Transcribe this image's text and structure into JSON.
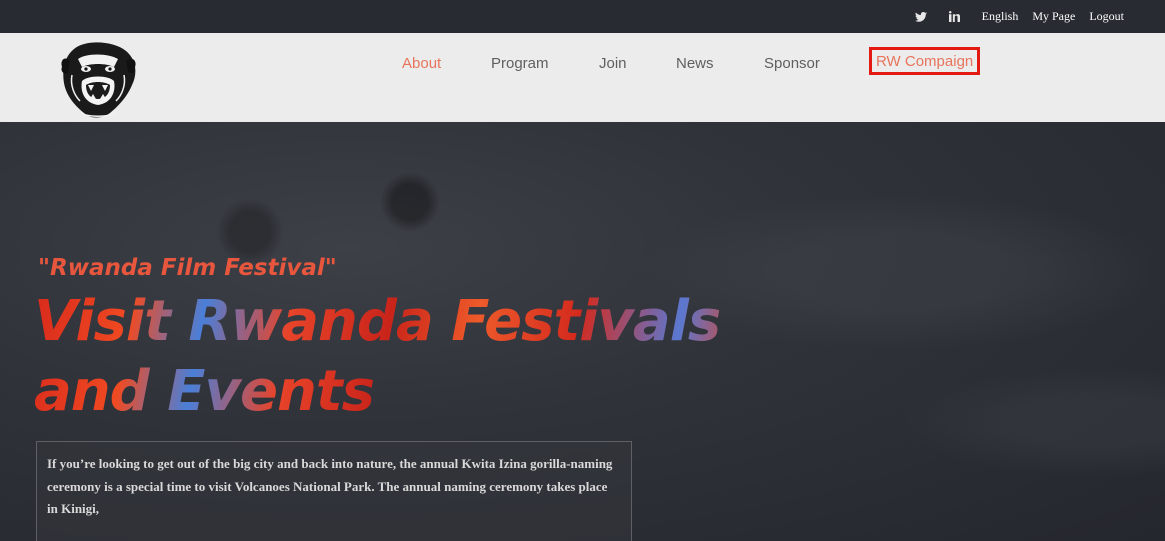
{
  "topbar": {
    "icons": [
      {
        "name": "twitter-icon",
        "glyph": "twitter"
      },
      {
        "name": "linkedin-icon",
        "glyph": "in"
      }
    ],
    "links": [
      {
        "name": "english-link",
        "label": "English"
      },
      {
        "name": "my-page-link",
        "label": "My Page"
      },
      {
        "name": "logout-link",
        "label": "Logout"
      }
    ]
  },
  "nav": {
    "items": [
      {
        "name": "nav-about",
        "label": "About",
        "state": "active"
      },
      {
        "name": "nav-program",
        "label": "Program"
      },
      {
        "name": "nav-join",
        "label": "Join"
      },
      {
        "name": "nav-news",
        "label": "News"
      },
      {
        "name": "nav-sponsor",
        "label": "Sponsor"
      },
      {
        "name": "nav-rw-compaign",
        "label": "RW Compaign",
        "state": "highlighted"
      }
    ]
  },
  "hero": {
    "subtitle": "\"Rwanda Film Festival\"",
    "title_line1": "Visit Rwanda Festivals",
    "title_line2": "and Events",
    "description": "If you’re looking to get out of the big city and back into nature, the annual Kwita Izina gorilla-naming ceremony is a special time to visit Volcanoes National Park. The annual naming ceremony takes place in Kinigi,"
  },
  "colors": {
    "topbar_bg": "#282b32",
    "header_bg": "#ececec",
    "accent": "#e8745c",
    "highlight_border": "#e31a12",
    "title_red": "#d82a1c",
    "title_blue": "#4a7fd8"
  }
}
